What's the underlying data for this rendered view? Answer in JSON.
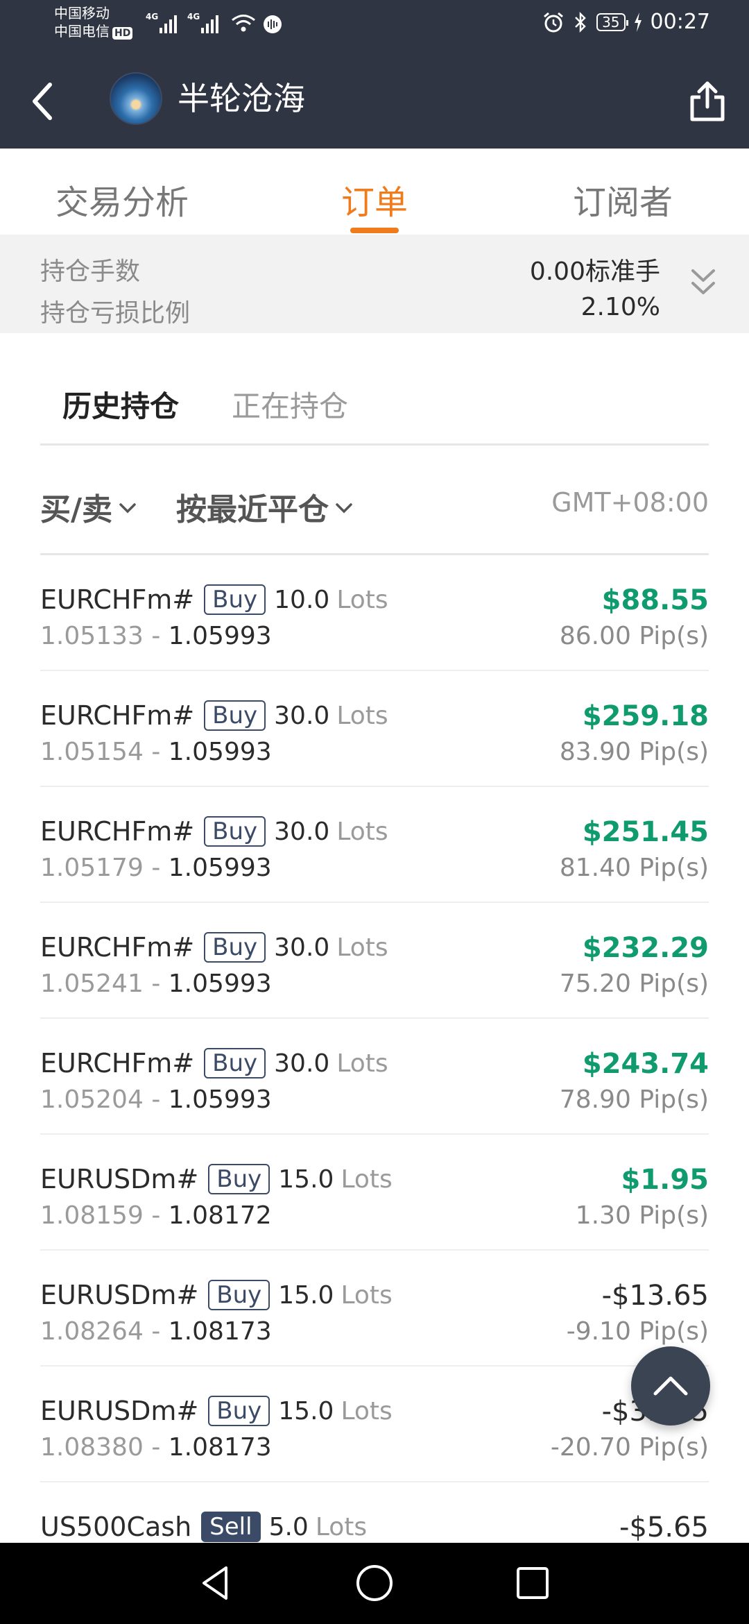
{
  "status_bar": {
    "carrier1": "中国移动",
    "carrier2": "中国电信",
    "hd": "HD",
    "net1": "4G",
    "net2": "4G",
    "battery": "35",
    "time": "00:27"
  },
  "header": {
    "title": "半轮沧海",
    "back_icon": "back-arrow-icon",
    "share_icon": "share-icon"
  },
  "tabs": [
    {
      "label": "交易分析",
      "active": false
    },
    {
      "label": "订单",
      "active": true
    },
    {
      "label": "订阅者",
      "active": false
    }
  ],
  "summary": {
    "position_lots_label": "持仓手数",
    "position_lots_value": "0.00标准手",
    "position_pl_label": "持仓亏损比例",
    "position_pl_value": "2.10%"
  },
  "subtabs": {
    "history": "历史持仓",
    "open": "正在持仓"
  },
  "filters": {
    "side": "买/卖",
    "sort": "按最近平仓",
    "timezone": "GMT+08:00"
  },
  "orders": [
    {
      "symbol": "EURCHFm#",
      "side": "Buy",
      "lots": "10.0",
      "lots_unit": "Lots",
      "open": "1.05133",
      "sep": "-",
      "close": "1.05993",
      "profit": "$88.55",
      "pips": "86.00 Pip(s)",
      "positive": true
    },
    {
      "symbol": "EURCHFm#",
      "side": "Buy",
      "lots": "30.0",
      "lots_unit": "Lots",
      "open": "1.05154",
      "sep": "-",
      "close": "1.05993",
      "profit": "$259.18",
      "pips": "83.90 Pip(s)",
      "positive": true
    },
    {
      "symbol": "EURCHFm#",
      "side": "Buy",
      "lots": "30.0",
      "lots_unit": "Lots",
      "open": "1.05179",
      "sep": "-",
      "close": "1.05993",
      "profit": "$251.45",
      "pips": "81.40 Pip(s)",
      "positive": true
    },
    {
      "symbol": "EURCHFm#",
      "side": "Buy",
      "lots": "30.0",
      "lots_unit": "Lots",
      "open": "1.05241",
      "sep": "-",
      "close": "1.05993",
      "profit": "$232.29",
      "pips": "75.20 Pip(s)",
      "positive": true
    },
    {
      "symbol": "EURCHFm#",
      "side": "Buy",
      "lots": "30.0",
      "lots_unit": "Lots",
      "open": "1.05204",
      "sep": "-",
      "close": "1.05993",
      "profit": "$243.74",
      "pips": "78.90 Pip(s)",
      "positive": true
    },
    {
      "symbol": "EURUSDm#",
      "side": "Buy",
      "lots": "15.0",
      "lots_unit": "Lots",
      "open": "1.08159",
      "sep": "-",
      "close": "1.08172",
      "profit": "$1.95",
      "pips": "1.30 Pip(s)",
      "positive": true
    },
    {
      "symbol": "EURUSDm#",
      "side": "Buy",
      "lots": "15.0",
      "lots_unit": "Lots",
      "open": "1.08264",
      "sep": "-",
      "close": "1.08173",
      "profit": "-$13.65",
      "pips": "-9.10 Pip(s)",
      "positive": false
    },
    {
      "symbol": "EURUSDm#",
      "side": "Buy",
      "lots": "15.0",
      "lots_unit": "Lots",
      "open": "1.08380",
      "sep": "-",
      "close": "1.08173",
      "profit": "-$31.05",
      "pips": "-20.70 Pip(s)",
      "positive": false
    },
    {
      "symbol": "US500Cash",
      "side": "Sell",
      "lots": "5.0",
      "lots_unit": "Lots",
      "open": "",
      "sep": "",
      "close": "",
      "profit": "-$5.65",
      "pips": "",
      "positive": false
    }
  ],
  "fab_icon": "chevron-up-icon",
  "colors": {
    "header_bg": "#2f3542",
    "accent": "#f07b1b",
    "profit_green": "#0f9b6e"
  }
}
